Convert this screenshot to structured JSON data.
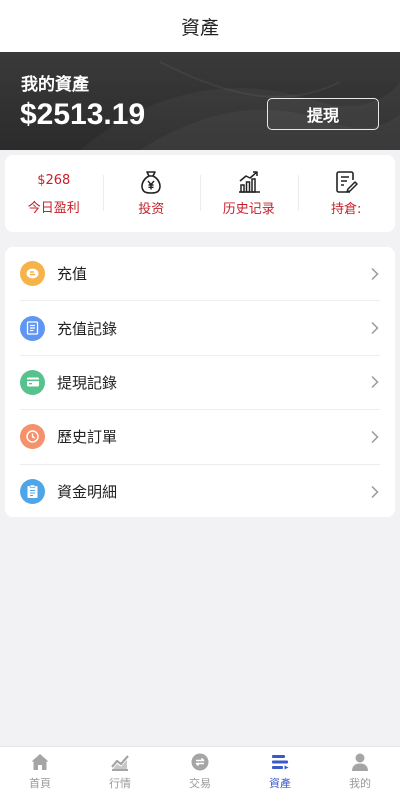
{
  "header": {
    "title": "資產"
  },
  "banner": {
    "label": "我的資產",
    "amount": "$2513.19",
    "withdraw_label": "提現"
  },
  "quick": {
    "today_profit_value": "$268",
    "today_profit_label": "今日盈利",
    "invest_label": "投资",
    "invest_icon": "money-bag-icon",
    "history_label": "历史记录",
    "history_icon": "bar-chart-icon",
    "holdings_label": "持倉:",
    "holdings_icon": "edit-document-icon",
    "accent_color": "#c8202a"
  },
  "menu": {
    "items": [
      {
        "label": "充值",
        "icon": "coin-icon",
        "color": "#f5b349"
      },
      {
        "label": "充值記錄",
        "icon": "document-icon",
        "color": "#5f96f2"
      },
      {
        "label": "提現記錄",
        "icon": "card-icon",
        "color": "#58c28e"
      },
      {
        "label": "歷史訂單",
        "icon": "clock-icon",
        "color": "#f5926b"
      },
      {
        "label": "資金明細",
        "icon": "clipboard-icon",
        "color": "#4ea6e8"
      }
    ]
  },
  "tabbar": {
    "items": [
      {
        "label": "首頁",
        "icon": "home-icon"
      },
      {
        "label": "行情",
        "icon": "chart-icon"
      },
      {
        "label": "交易",
        "icon": "exchange-icon"
      },
      {
        "label": "資產",
        "icon": "wallet-icon",
        "active": true
      },
      {
        "label": "我的",
        "icon": "user-icon"
      }
    ],
    "active_color": "#3a5ac8",
    "inactive_color": "#9a9a9a"
  }
}
